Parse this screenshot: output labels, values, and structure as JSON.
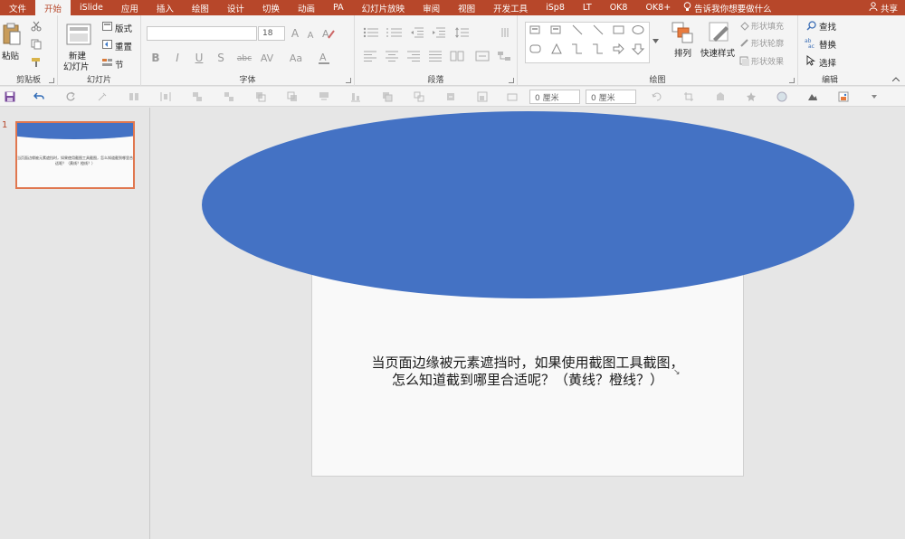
{
  "tabs": [
    {
      "label": "文件"
    },
    {
      "label": "开始"
    },
    {
      "label": "iSlide"
    },
    {
      "label": "应用"
    },
    {
      "label": "插入"
    },
    {
      "label": "绘图"
    },
    {
      "label": "设计"
    },
    {
      "label": "切换"
    },
    {
      "label": "动画"
    },
    {
      "label": "PA"
    },
    {
      "label": "幻灯片放映"
    },
    {
      "label": "审阅"
    },
    {
      "label": "视图"
    },
    {
      "label": "开发工具"
    },
    {
      "label": "iSp8"
    },
    {
      "label": "LT"
    },
    {
      "label": "OK8"
    },
    {
      "label": "OK8+"
    }
  ],
  "tell_me": "告诉我你想要做什么",
  "share": "共享",
  "clipboard": {
    "paste": "粘贴",
    "group_label": "剪贴板"
  },
  "slides_group": {
    "new_slide_1": "新建",
    "new_slide_2": "幻灯片",
    "layout": "版式",
    "reset": "重置",
    "section": "节",
    "group_label": "幻灯片"
  },
  "font_group": {
    "font_size": "18",
    "bold": "B",
    "italic": "I",
    "underline": "U",
    "strike": "S",
    "spacing": "abc",
    "case": "Aa",
    "group_label": "字体"
  },
  "paragraph_group": {
    "group_label": "段落"
  },
  "drawing_group": {
    "arrange": "排列",
    "quick_styles": "快速样式",
    "shape_fill": "形状填充",
    "shape_outline": "形状轮廓",
    "shape_effects": "形状效果",
    "group_label": "绘图"
  },
  "editing_group": {
    "find": "查找",
    "replace": "替换",
    "select": "选择",
    "group_label": "编辑"
  },
  "qat": {
    "width_value": "0 厘米",
    "height_value": "0 厘米"
  },
  "thumbnail": {
    "number": "1",
    "text": "当页面边缘被元素遮挡时，如果使用截图工具截图，怎么知道截到哪里合适呢？（黄线？橙线？）"
  },
  "slide": {
    "line1": "当页面边缘被元素遮挡时，如果使用截图工具截图，",
    "line2": "怎么知道截到哪里合适呢？（黄线？橙线？）"
  },
  "colors": {
    "accent": "#b7472a",
    "shape_fill": "#4472c4",
    "selection": "#e0774f"
  }
}
